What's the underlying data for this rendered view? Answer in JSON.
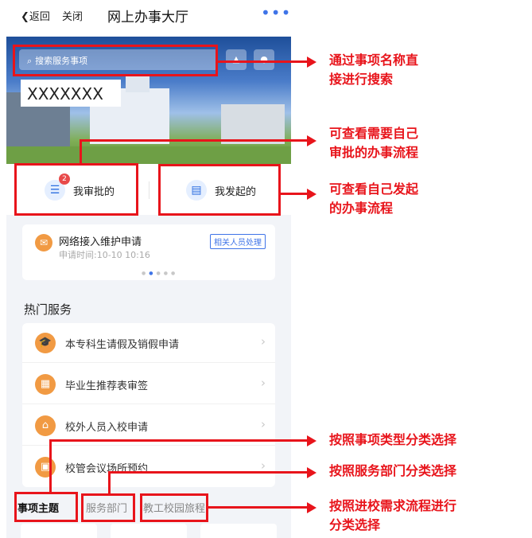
{
  "topbar": {
    "back_label": "返回",
    "close_label": "关闭",
    "title": "网上办事大厅",
    "more_icon": "•••"
  },
  "banner": {
    "search_placeholder": "搜索服务事项",
    "masked_text": "XXXXXXX"
  },
  "quick_entries": [
    {
      "label": "我审批的",
      "badge": "2"
    },
    {
      "label": "我发起的"
    }
  ],
  "notice": {
    "title": "网络接入维护申请",
    "time": "申请时间:10-10 10:16",
    "tag": "相关人员处理"
  },
  "hot_services": {
    "title": "热门服务",
    "items": [
      {
        "label": "本专科生请假及销假申请"
      },
      {
        "label": "毕业生推荐表审签"
      },
      {
        "label": "校外人员入校申请"
      },
      {
        "label": "校管会议场所预约"
      }
    ]
  },
  "category_tabs": [
    {
      "label": "事项主题"
    },
    {
      "label": "服务部门"
    },
    {
      "label": "教工校园旅程"
    }
  ],
  "annotations": {
    "search": [
      "通过事项名称直",
      "接进行搜索"
    ],
    "approve": [
      "可查看需要自己",
      "审批的办事流程"
    ],
    "initiate": [
      "可查看自己发起",
      "的办事流程"
    ],
    "by_type": [
      "按照事项类型分类选择"
    ],
    "by_dept": [
      "按照服务部门分类选择"
    ],
    "by_flow": [
      "按照进校需求流程进行",
      "分类选择"
    ]
  },
  "colors": {
    "annotation_red": "#e8141b",
    "accent_blue": "#3f74e8",
    "service_orange": "#f19a43"
  }
}
